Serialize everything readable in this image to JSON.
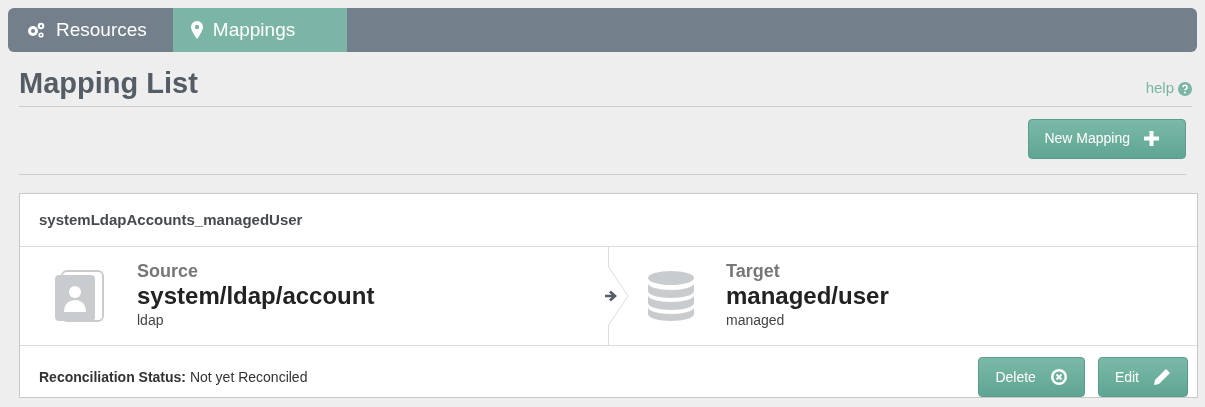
{
  "tabs": [
    {
      "label": "Resources",
      "selected": false
    },
    {
      "label": "Mappings",
      "selected": true
    }
  ],
  "page": {
    "title": "Mapping List",
    "help": "help"
  },
  "new_button": {
    "label": "New Mapping"
  },
  "mappings": [
    {
      "name": "systemLdapAccounts_managedUser",
      "source": {
        "kind": "system",
        "heading": "Source",
        "path": "system/ldap/account",
        "type": "ldap"
      },
      "target": {
        "kind": "managed",
        "heading": "Target",
        "path": "managed/user",
        "type": "managed"
      },
      "status_label": "Reconciliation Status:",
      "status": "Not yet Reconciled",
      "buttons": [
        {
          "label": "Delete"
        },
        {
          "label": "Edit"
        }
      ]
    }
  ]
}
